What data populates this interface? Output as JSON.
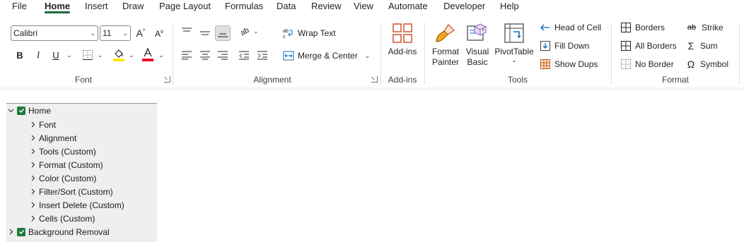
{
  "menu": {
    "items": [
      {
        "label": "File"
      },
      {
        "label": "Home"
      },
      {
        "label": "Insert"
      },
      {
        "label": "Draw"
      },
      {
        "label": "Page Layout"
      },
      {
        "label": "Formulas"
      },
      {
        "label": "Data"
      },
      {
        "label": "Review"
      },
      {
        "label": "View"
      },
      {
        "label": "Automate"
      },
      {
        "label": "Developer"
      },
      {
        "label": "Help"
      }
    ],
    "active": "Home",
    "accent_color": "#1b6b3a"
  },
  "ribbon": {
    "font": {
      "name_value": "Calibri",
      "size_value": "11",
      "bold_label": "B",
      "italic_label": "I",
      "underline_label": "U",
      "fill_color": "#ffe600",
      "font_color": "#e81123",
      "group_label": "Font"
    },
    "alignment": {
      "wrap_text_label": "Wrap Text",
      "merge_center_label": "Merge & Center",
      "group_label": "Alignment"
    },
    "addins": {
      "button_label": "Add-ins",
      "group_label": "Add-ins"
    },
    "tools": {
      "format_painter_line1": "Format",
      "format_painter_line2": "Painter",
      "visual_basic_line1": "Visual",
      "visual_basic_line2": "Basic",
      "pivot_table_label": "PivotTable",
      "head_of_cell_label": "Head of Cell",
      "fill_down_label": "Fill Down",
      "show_dups_label": "Show Dups",
      "group_label": "Tools"
    },
    "format": {
      "borders_label": "Borders",
      "all_borders_label": "All Borders",
      "no_border_label": "No Border",
      "strike_label": "Strike",
      "sum_label": "Sum",
      "symbol_label": "Symbol",
      "group_label": "Format"
    }
  },
  "tree": {
    "root_label": "Home",
    "children": [
      {
        "label": "Font"
      },
      {
        "label": "Alignment"
      },
      {
        "label": "Tools (Custom)"
      },
      {
        "label": "Format (Custom)"
      },
      {
        "label": "Color (Custom)"
      },
      {
        "label": "Filter/Sort (Custom)"
      },
      {
        "label": "Insert Delete (Custom)"
      },
      {
        "label": "Cells (Custom)"
      }
    ],
    "sibling_label": "Background Removal",
    "check_color": "#1e7b3c"
  }
}
